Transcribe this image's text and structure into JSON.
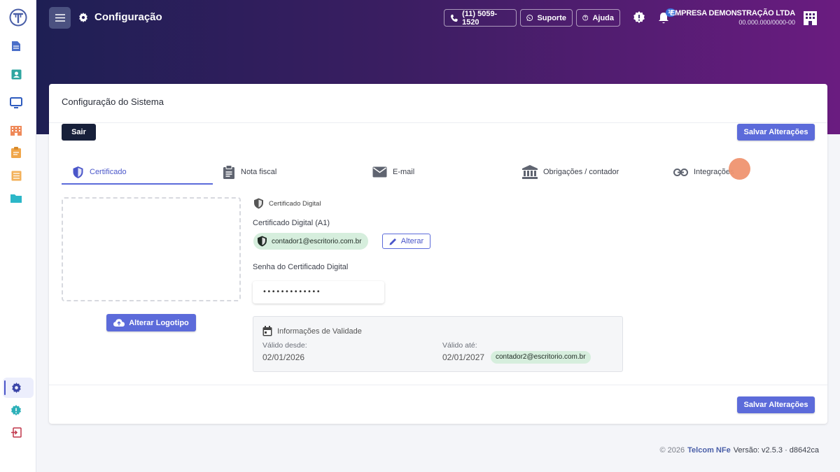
{
  "header": {
    "title": "Configuração",
    "phone_label": "(11) 5059-1520",
    "support_label": "Suporte",
    "help_label": "Ajuda",
    "notification_count": "12",
    "company_name": "EMPRESA DEMONSTRAÇÃO LTDA",
    "company_cnpj": "00.000.000/0000-00"
  },
  "sidebar": {
    "items": [
      "document-icon",
      "contact-icon",
      "monitor-icon",
      "building-icon",
      "clipboard-icon",
      "list-icon",
      "folder-icon",
      "settings-icon",
      "alert-icon",
      "logout-icon"
    ],
    "active": "settings-icon"
  },
  "card": {
    "title": "Configuração do Sistema",
    "exit_label": "Sair",
    "save_label": "Salvar Alterações"
  },
  "tabs": [
    {
      "label": "Certificado",
      "icon": "shield-icon",
      "active": true
    },
    {
      "label": "Nota fiscal",
      "icon": "clipboard-icon",
      "active": false
    },
    {
      "label": "E-mail",
      "icon": "mail-icon",
      "active": false
    },
    {
      "label": "Obrigações / contador",
      "icon": "bank-icon",
      "active": false
    },
    {
      "label": "Integrações",
      "icon": "link-icon",
      "active": false
    }
  ],
  "logo": {
    "button_label": "Alterar Logotipo"
  },
  "certificate": {
    "section_title": "Certificado Digital",
    "field_label": "Certificado Digital (A1)",
    "owner": "contador1@escritorio.com.br",
    "change_label": "Alterar",
    "password_label": "Senha do Certificado Digital",
    "password_value": "•••••••••••••"
  },
  "validity": {
    "title": "Informações de Validade",
    "from_label": "Válido desde:",
    "from_value": "02/01/2026",
    "until_label": "Válido até:",
    "until_value": "02/01/2027",
    "contact": "contador2@escritorio.com.br"
  },
  "footer": {
    "copyright": "© 2026",
    "brand": "Telcom NFe",
    "version": "Versão: v2.5.3 · d8642ca"
  },
  "colors": {
    "primary": "#5c6bda",
    "dark": "#17203a",
    "chip": "#d6eedd",
    "gradient_start": "#1e1f54",
    "gradient_end": "#6a1c80"
  }
}
